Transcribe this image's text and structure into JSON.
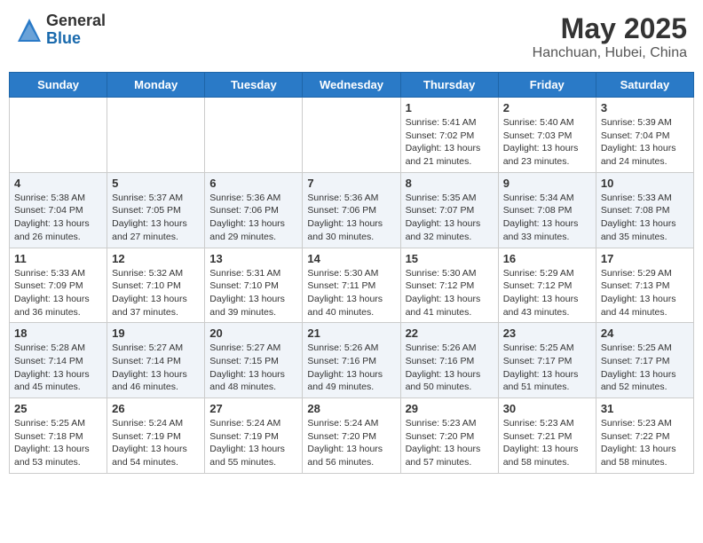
{
  "header": {
    "logo_general": "General",
    "logo_blue": "Blue",
    "month": "May 2025",
    "location": "Hanchuan, Hubei, China"
  },
  "weekdays": [
    "Sunday",
    "Monday",
    "Tuesday",
    "Wednesday",
    "Thursday",
    "Friday",
    "Saturday"
  ],
  "weeks": [
    [
      {
        "day": "",
        "info": ""
      },
      {
        "day": "",
        "info": ""
      },
      {
        "day": "",
        "info": ""
      },
      {
        "day": "",
        "info": ""
      },
      {
        "day": "1",
        "info": "Sunrise: 5:41 AM\nSunset: 7:02 PM\nDaylight: 13 hours\nand 21 minutes."
      },
      {
        "day": "2",
        "info": "Sunrise: 5:40 AM\nSunset: 7:03 PM\nDaylight: 13 hours\nand 23 minutes."
      },
      {
        "day": "3",
        "info": "Sunrise: 5:39 AM\nSunset: 7:04 PM\nDaylight: 13 hours\nand 24 minutes."
      }
    ],
    [
      {
        "day": "4",
        "info": "Sunrise: 5:38 AM\nSunset: 7:04 PM\nDaylight: 13 hours\nand 26 minutes."
      },
      {
        "day": "5",
        "info": "Sunrise: 5:37 AM\nSunset: 7:05 PM\nDaylight: 13 hours\nand 27 minutes."
      },
      {
        "day": "6",
        "info": "Sunrise: 5:36 AM\nSunset: 7:06 PM\nDaylight: 13 hours\nand 29 minutes."
      },
      {
        "day": "7",
        "info": "Sunrise: 5:36 AM\nSunset: 7:06 PM\nDaylight: 13 hours\nand 30 minutes."
      },
      {
        "day": "8",
        "info": "Sunrise: 5:35 AM\nSunset: 7:07 PM\nDaylight: 13 hours\nand 32 minutes."
      },
      {
        "day": "9",
        "info": "Sunrise: 5:34 AM\nSunset: 7:08 PM\nDaylight: 13 hours\nand 33 minutes."
      },
      {
        "day": "10",
        "info": "Sunrise: 5:33 AM\nSunset: 7:08 PM\nDaylight: 13 hours\nand 35 minutes."
      }
    ],
    [
      {
        "day": "11",
        "info": "Sunrise: 5:33 AM\nSunset: 7:09 PM\nDaylight: 13 hours\nand 36 minutes."
      },
      {
        "day": "12",
        "info": "Sunrise: 5:32 AM\nSunset: 7:10 PM\nDaylight: 13 hours\nand 37 minutes."
      },
      {
        "day": "13",
        "info": "Sunrise: 5:31 AM\nSunset: 7:10 PM\nDaylight: 13 hours\nand 39 minutes."
      },
      {
        "day": "14",
        "info": "Sunrise: 5:30 AM\nSunset: 7:11 PM\nDaylight: 13 hours\nand 40 minutes."
      },
      {
        "day": "15",
        "info": "Sunrise: 5:30 AM\nSunset: 7:12 PM\nDaylight: 13 hours\nand 41 minutes."
      },
      {
        "day": "16",
        "info": "Sunrise: 5:29 AM\nSunset: 7:12 PM\nDaylight: 13 hours\nand 43 minutes."
      },
      {
        "day": "17",
        "info": "Sunrise: 5:29 AM\nSunset: 7:13 PM\nDaylight: 13 hours\nand 44 minutes."
      }
    ],
    [
      {
        "day": "18",
        "info": "Sunrise: 5:28 AM\nSunset: 7:14 PM\nDaylight: 13 hours\nand 45 minutes."
      },
      {
        "day": "19",
        "info": "Sunrise: 5:27 AM\nSunset: 7:14 PM\nDaylight: 13 hours\nand 46 minutes."
      },
      {
        "day": "20",
        "info": "Sunrise: 5:27 AM\nSunset: 7:15 PM\nDaylight: 13 hours\nand 48 minutes."
      },
      {
        "day": "21",
        "info": "Sunrise: 5:26 AM\nSunset: 7:16 PM\nDaylight: 13 hours\nand 49 minutes."
      },
      {
        "day": "22",
        "info": "Sunrise: 5:26 AM\nSunset: 7:16 PM\nDaylight: 13 hours\nand 50 minutes."
      },
      {
        "day": "23",
        "info": "Sunrise: 5:25 AM\nSunset: 7:17 PM\nDaylight: 13 hours\nand 51 minutes."
      },
      {
        "day": "24",
        "info": "Sunrise: 5:25 AM\nSunset: 7:17 PM\nDaylight: 13 hours\nand 52 minutes."
      }
    ],
    [
      {
        "day": "25",
        "info": "Sunrise: 5:25 AM\nSunset: 7:18 PM\nDaylight: 13 hours\nand 53 minutes."
      },
      {
        "day": "26",
        "info": "Sunrise: 5:24 AM\nSunset: 7:19 PM\nDaylight: 13 hours\nand 54 minutes."
      },
      {
        "day": "27",
        "info": "Sunrise: 5:24 AM\nSunset: 7:19 PM\nDaylight: 13 hours\nand 55 minutes."
      },
      {
        "day": "28",
        "info": "Sunrise: 5:24 AM\nSunset: 7:20 PM\nDaylight: 13 hours\nand 56 minutes."
      },
      {
        "day": "29",
        "info": "Sunrise: 5:23 AM\nSunset: 7:20 PM\nDaylight: 13 hours\nand 57 minutes."
      },
      {
        "day": "30",
        "info": "Sunrise: 5:23 AM\nSunset: 7:21 PM\nDaylight: 13 hours\nand 58 minutes."
      },
      {
        "day": "31",
        "info": "Sunrise: 5:23 AM\nSunset: 7:22 PM\nDaylight: 13 hours\nand 58 minutes."
      }
    ]
  ]
}
